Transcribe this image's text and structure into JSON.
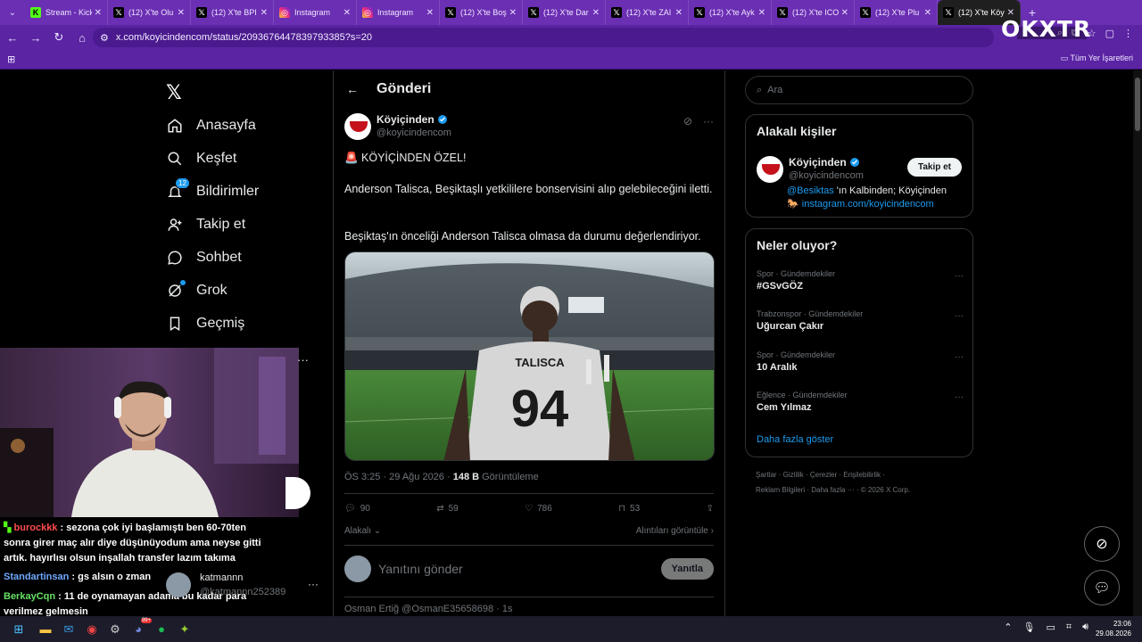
{
  "browser": {
    "tabs": [
      {
        "label": "Stream - Kick",
        "favicon": "kick-icon",
        "color": "#53fc18"
      },
      {
        "label": "(12) X'te Olu",
        "favicon": "x-icon",
        "color": "#000000"
      },
      {
        "label": "(12) X'te BPI",
        "favicon": "x-icon",
        "color": "#000000"
      },
      {
        "label": "Instagram",
        "favicon": "instagram-icon",
        "color": "#e1306c"
      },
      {
        "label": "Instagram",
        "favicon": "instagram-icon",
        "color": "#e1306c"
      },
      {
        "label": "(12) X'te Boş",
        "favicon": "x-icon",
        "color": "#000000"
      },
      {
        "label": "(12) X'te Dar",
        "favicon": "x-icon",
        "color": "#000000"
      },
      {
        "label": "(12) X'te ZAI",
        "favicon": "x-icon",
        "color": "#000000"
      },
      {
        "label": "(12) X'te Ayk",
        "favicon": "x-icon",
        "color": "#000000"
      },
      {
        "label": "(12) X'te ICO",
        "favicon": "x-icon",
        "color": "#000000"
      },
      {
        "label": "(12) X'te Plu",
        "favicon": "x-icon",
        "color": "#000000"
      },
      {
        "label": "(12) X'te Köy",
        "favicon": "x-icon",
        "color": "#000000",
        "active": true
      }
    ],
    "url": "x.com/koyicindencom/status/2093676447839793385?s=20",
    "bookmarks_all": "Tüm Yer İşaretleri",
    "brand_overlay": "OKXTR"
  },
  "nav": {
    "items": [
      {
        "label": "Anasayfa",
        "icon": "home-icon"
      },
      {
        "label": "Keşfet",
        "icon": "search-icon"
      },
      {
        "label": "Bildirimler",
        "icon": "bell-icon",
        "badge": "12"
      },
      {
        "label": "Takip et",
        "icon": "follow-icon"
      },
      {
        "label": "Sohbet",
        "icon": "chat-icon"
      },
      {
        "label": "Grok",
        "icon": "grok-icon"
      },
      {
        "label": "Geçmiş",
        "icon": "bookmark-icon"
      }
    ]
  },
  "post": {
    "header_title": "Gönderi",
    "author_name": "Köyiçinden",
    "author_handle": "@koyicindencom",
    "line1": "🚨 KÖYİÇİNDEN ÖZEL!",
    "line2": "Anderson Talisca, Beşiktaşlı yetkililere bonservisini alıp gelebileceğini iletti.",
    "line3": "Beşiktaş'ın önceliği Anderson Talisca olmasa da durumu değerlendiriyor.",
    "image": {
      "jersey_name": "TALISCA",
      "jersey_number": "94"
    },
    "time": "ÖS 3:25 · 29 Ağu 2026",
    "views_count": "148 B",
    "views_label": "Görüntüleme",
    "replies": "90",
    "reposts": "59",
    "likes": "786",
    "bookmarks": "53",
    "sort_label": "Alakalı",
    "quotes_label": "Alıntıları görüntüle",
    "reply_placeholder": "Yanıtını gönder",
    "reply_button": "Yanıtla",
    "next_post_preview": "Osman Ertiğ @OsmanE35658698 · 1s"
  },
  "sidebar": {
    "search_placeholder": "Ara",
    "related_title": "Alakalı kişiler",
    "related_name": "Köyiçinden",
    "related_handle": "@koyicindencom",
    "follow_button": "Takip et",
    "bio_mention": "@Besiktas",
    "bio_rest": " 'ın Kalbinden; Köyiçinden",
    "bio_link": "instagram.com/koyicindencom",
    "trends_title": "Neler oluyor?",
    "trends": [
      {
        "category": "Spor · Gündemdekiler",
        "name": "#GSvGÖZ"
      },
      {
        "category": "Trabzonspor · Gündemdekiler",
        "name": "Uğurcan Çakır"
      },
      {
        "category": "Spor · Gündemdekiler",
        "name": "10 Aralık"
      },
      {
        "category": "Eğlence · Gündemdekiler",
        "name": "Cem Yılmaz"
      }
    ],
    "show_more": "Daha fazla göster",
    "footer_line1": "Şartlar  ·  Gizlilik  ·  Çerezler  ·  Erişilebilirlik  ·",
    "footer_line2": "Reklam Bilgileri  ·  Daha fazla ···  ·  © 2026 X Corp."
  },
  "stream": {
    "chat": [
      {
        "user": "burockkk",
        "text": " : sezona çok iyi başlamıştı ben 60-70ten"
      },
      {
        "user": "",
        "text": "sonra girer maç alır diye düşünüyodum ama neyse gitti"
      },
      {
        "user": "",
        "text": "artık. hayırlısı olsun inşallah transfer lazım takıma"
      },
      {
        "user": "Standartinsan",
        "text": " : gs alsın o zman"
      },
      {
        "user": "BerkayCqn",
        "text": " : 11 de oynamayan adama bu kadar para"
      },
      {
        "user": "",
        "text": "verilmez gelmesin"
      }
    ],
    "follow_name": "katmannn",
    "follow_handle": "@katmannn252389"
  },
  "taskbar": {
    "time": "23:06",
    "date": "29.08.2026",
    "discord_badge": "99+"
  },
  "colors": {
    "browser_purple": "#6b2fb3",
    "x_blue": "#1d9bf0",
    "besiktas_red": "#c4111b"
  }
}
